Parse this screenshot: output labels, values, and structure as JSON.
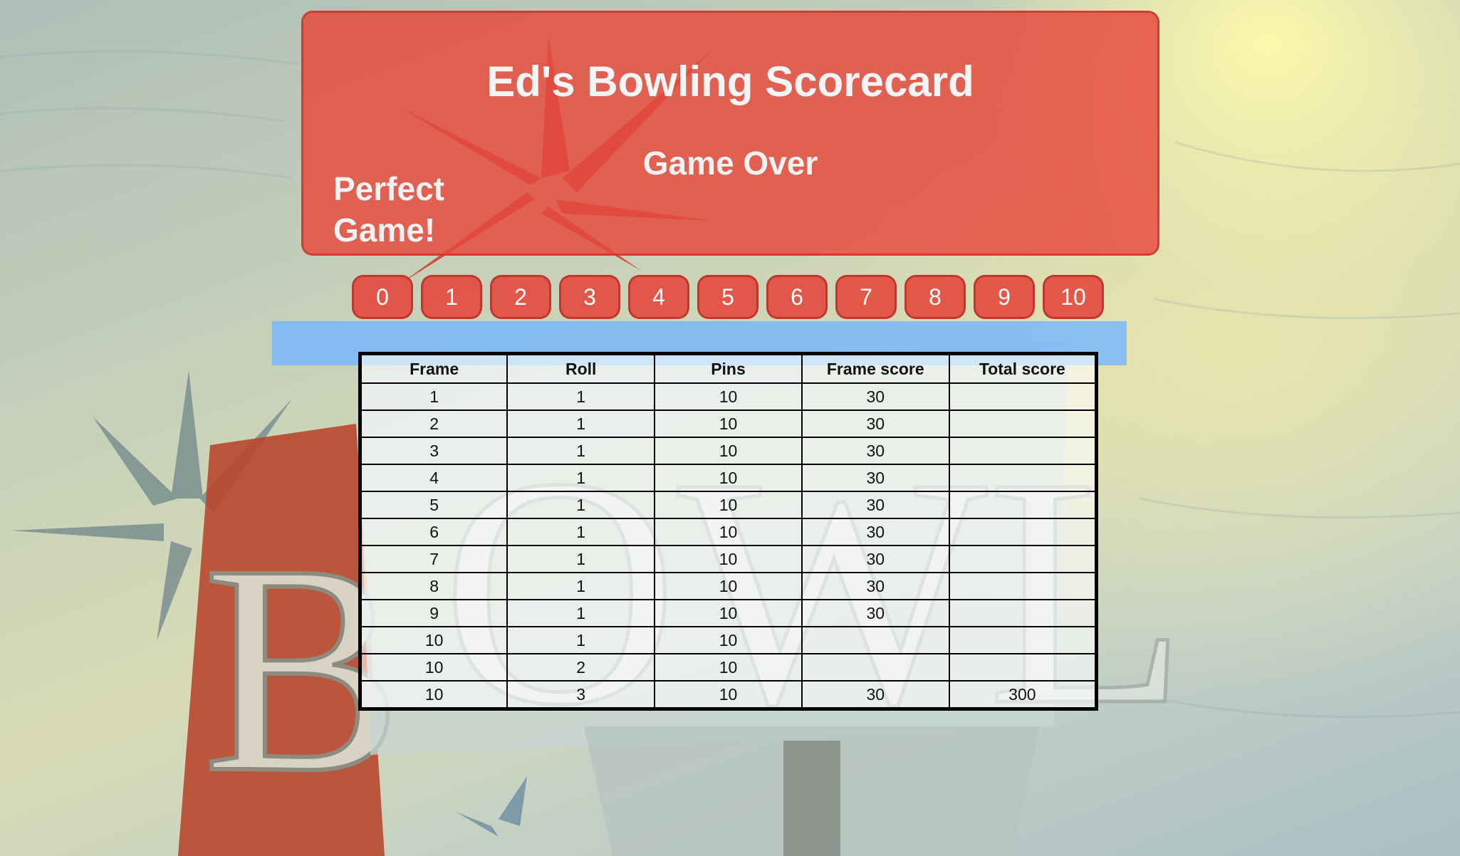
{
  "header": {
    "title": "Ed's Bowling Scorecard",
    "status": "Game Over",
    "perfect": "Perfect Game!"
  },
  "pin_buttons": [
    "0",
    "1",
    "2",
    "3",
    "4",
    "5",
    "6",
    "7",
    "8",
    "9",
    "10"
  ],
  "table": {
    "columns": [
      "Frame",
      "Roll",
      "Pins",
      "Frame score",
      "Total score"
    ],
    "rows": [
      [
        "1",
        "1",
        "10",
        "30",
        ""
      ],
      [
        "2",
        "1",
        "10",
        "30",
        ""
      ],
      [
        "3",
        "1",
        "10",
        "30",
        ""
      ],
      [
        "4",
        "1",
        "10",
        "30",
        ""
      ],
      [
        "5",
        "1",
        "10",
        "30",
        ""
      ],
      [
        "6",
        "1",
        "10",
        "30",
        ""
      ],
      [
        "7",
        "1",
        "10",
        "30",
        ""
      ],
      [
        "8",
        "1",
        "10",
        "30",
        ""
      ],
      [
        "9",
        "1",
        "10",
        "30",
        ""
      ],
      [
        "10",
        "1",
        "10",
        "",
        ""
      ],
      [
        "10",
        "2",
        "10",
        "",
        ""
      ],
      [
        "10",
        "3",
        "10",
        "30",
        "300"
      ]
    ]
  },
  "colors": {
    "banner": "#e7483a",
    "button": "#e4463a",
    "blue_bar": "#78b9fa"
  }
}
